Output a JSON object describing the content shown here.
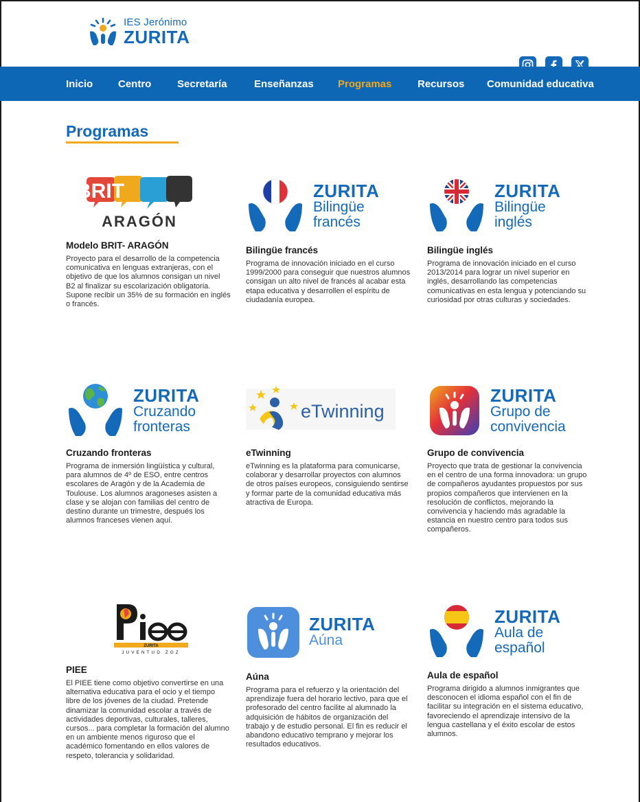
{
  "header": {
    "logo_small": "IES Jerónimo",
    "logo_big": "ZURITA",
    "socials": [
      {
        "icon": "instagram-icon",
        "label": "Instagram"
      },
      {
        "icon": "facebook-icon",
        "label": "Facebook"
      },
      {
        "icon": "x-icon",
        "label": "X"
      }
    ]
  },
  "nav": {
    "items": [
      "Inicio",
      "Centro",
      "Secretaría",
      "Enseñanzas",
      "Programas",
      "Recursos",
      "Comunidad educativa"
    ],
    "active": "Programas"
  },
  "page": {
    "title": "Programas"
  },
  "colors": {
    "primary": "#1469b8",
    "accent": "#f0a81c"
  },
  "programs": [
    {
      "logo": {
        "brit": "BRIT",
        "region": "ARAGÓN"
      },
      "title": "Modelo BRIT- ARAGÓN",
      "text": "Proyecto para el desarrollo de la competencia comunicativa en lenguas extranjeras, con el objetivo de que los alumnos consigan un nivel B2 al finalizar su escolarización obligatoria. Supone recibir un 35% de su formación en inglés o francés."
    },
    {
      "logo": {
        "brand": "ZURITA",
        "line1": "Bilingüe",
        "line2": "francés"
      },
      "title": "Bilingüe francés",
      "text": "Programa de innovación iniciado en el curso 1999/2000 para conseguir que nuestros alumnos consigan un alto nivel de francés al acabar esta etapa educativa y desarrollen el espíritu de ciudadanía europea."
    },
    {
      "logo": {
        "brand": "ZURITA",
        "line1": "Bilingüe",
        "line2": "inglés"
      },
      "title": "Bilingüe inglés",
      "text": "Programa de innovación iniciado en el curso 2013/2014 para lograr un nivel superior en inglés, desarrollando las competencias comunicativas en esta lengua y potenciando su curiosidad por otras culturas y sociedades."
    },
    {
      "logo": {
        "brand": "ZURITA",
        "line1": "Cruzando",
        "line2": "fronteras"
      },
      "title": "Cruzando fronteras",
      "text": "Programa de inmersión lingüística y cultural, para alumnos de 4º de ESO, entre centros escolares de Aragón y de la Academia de Toulouse. Los alumnos aragoneses asisten a clase y se alojan con familias del centro de destino durante un trimestre, después los alumnos franceses vienen aquí."
    },
    {
      "logo": {
        "brand": "eTwinning"
      },
      "title": "eTwinning",
      "text": "eTwinning es la plataforma para comunicarse, colaborar y desarrollar proyectos con alumnos de otros países europeos, consiguiendo sentirse y formar parte de la comunidad educativa más atractiva de Europa."
    },
    {
      "logo": {
        "brand": "ZURITA",
        "line1": "Grupo de",
        "line2": "convivencia"
      },
      "title": "Grupo de convivencia",
      "text": "Proyecto que trata de gestionar la convivencia en el centro de una forma innovadora: un grupo de compañeros ayudantes propuestos por sus propios compañeros que intervienen en la resolución de conflictos, mejorando la convivencia y haciendo más agradable la estancia en nuestro centro para todos sus compañeros."
    },
    {
      "logo": {
        "brand": "ZURITA",
        "tagline": "JUVENTUD ZGZ"
      },
      "title": "PIEE",
      "text": "El PIEE tiene como objetivo convertirse en una alternativa educativa para el ocio y el tiempo libre de los jóvenes de la ciudad. Pretende dinamizar la comunidad escolar a través de actividades deportivas, culturales, talleres, cursos... para completar la formación del alumno en un ambiente menos riguroso que el académico fomentando en ellos valores de respeto, tolerancia y solidaridad."
    },
    {
      "logo": {
        "brand": "ZURITA",
        "line1": "Aúna"
      },
      "title": "Aúna",
      "text": "Programa para el refuerzo y la orientación del aprendizaje fuera del horario lectivo, para que el profesorado del centro facilite al alumnado la adquisición de hábitos de organización del trabajo y de estudio personal. El fin es reducir el abandono educativo temprano y mejorar los resultados educativos."
    },
    {
      "logo": {
        "brand": "ZURITA",
        "line1": "Aula de",
        "line2": "español"
      },
      "title": "Aula de español",
      "text": "Programa dirigido a alumnos inmigrantes que desconocen el idioma español con el fin de facilitar su integración en el sistema educativo, favoreciendo el aprendizaje intensivo de la lengua castellana y el éxito escolar de estos alumnos."
    }
  ]
}
